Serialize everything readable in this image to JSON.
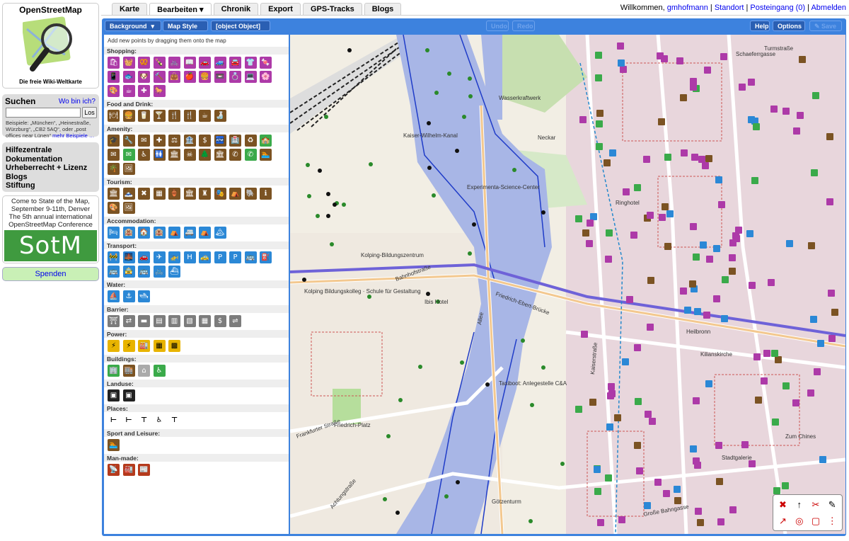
{
  "sidebar": {
    "logo_title": "OpenStreetMap",
    "logo_subtitle": "Die freie Wiki-Weltkarte",
    "search_title": "Suchen",
    "where_link": "Wo bin ich?",
    "search_value": "",
    "search_button": "Los",
    "search_help": "Beispiele: „München“, „Heinestraße, Würzburg“, „CB2 5AQ“, oder „post offices near Lünen“",
    "search_more": "mehr Beispiele …",
    "links": [
      "Hilfezentrale",
      "Dokumentation",
      "Urheberrecht + Lizenz",
      "Blogs",
      "Stiftung"
    ],
    "sotm_text_1": "Come to State of the Map,",
    "sotm_text_2": "September 9-11th, Denver",
    "sotm_text_3": "The 5th annual international",
    "sotm_text_4": "OpenStreetMap Conference",
    "sotm_logo": "SotM",
    "donate": "Spenden"
  },
  "tabs": [
    "Karte",
    "Bearbeiten ▾",
    "Chronik",
    "Export",
    "GPS-Tracks",
    "Blogs"
  ],
  "userbar": {
    "welcome": "Willkommen, ",
    "user": "gmhofmann",
    "sep": " | ",
    "location": "Standort",
    "inbox": "Posteingang (0)",
    "logout": "Abmelden"
  },
  "toolbar": {
    "background": "Background",
    "map_style": "Map Style",
    "object": "[object Object]",
    "undo": "Undo",
    "redo": "Redo",
    "help": "Help",
    "options": "Options",
    "save": "Save"
  },
  "palette": {
    "hint": "Add new points by dragging them onto the map",
    "categories": [
      {
        "label": "Shopping:",
        "style": "c-shop",
        "icons": [
          "🛍",
          "🧺",
          "🥨",
          "🍾",
          "🚲",
          "📖",
          "🚗",
          "🚙",
          "🚘",
          "👕",
          "🍬",
          "📱",
          "🐟",
          "🐶",
          "🔨",
          "👜",
          "🍎",
          "🍔",
          "📼",
          "💍",
          "💻",
          "🌸",
          "🎨",
          "☕",
          "✚",
          "🐎"
        ]
      },
      {
        "label": "Food and Drink:",
        "style": "c-food",
        "icons": [
          "🍽",
          "🍔",
          "🥛",
          "🍸",
          "🍴",
          "🍴",
          "☕",
          "🍶"
        ]
      },
      {
        "label": "Amenity:",
        "style": "c-amen",
        "icons": [
          "🎓",
          "🔧",
          "✉",
          "✚",
          "⚖",
          "🏦",
          "$",
          "🏧",
          "🏥",
          "♻",
          "🏫",
          "✉",
          "✉",
          "♿",
          "🚻",
          "🏛",
          "☠",
          "🌲",
          "🏛",
          "✆",
          "✆",
          "🏊",
          "🌴",
          "🖼"
        ]
      },
      {
        "label": "Tourism:",
        "style": "c-tour",
        "icons": [
          "🏛",
          "🗻",
          "✖",
          "▦",
          "🏺",
          "🏛",
          "♜",
          "🎭",
          "⛺",
          "🐘",
          "ℹ",
          "🎨",
          "🖼"
        ]
      },
      {
        "label": "Accommodation:",
        "style": "c-blue",
        "icons": [
          "🛏",
          "🏨",
          "🏠",
          "🏨",
          "⛺",
          "🚐",
          "⛺",
          "🏔"
        ]
      },
      {
        "label": "Transport:",
        "style": "c-blue",
        "icons": [
          "🚧",
          "🌉",
          "🚗",
          "✈",
          "🚁",
          "H",
          "🚕",
          "P",
          "P",
          "🚌",
          "⛽",
          "🚌",
          "🚖",
          "🚌",
          "🚲",
          "⛴"
        ]
      },
      {
        "label": "Water:",
        "style": "c-blue",
        "icons": [
          "⛵",
          "⚓",
          "🛥"
        ]
      },
      {
        "label": "Barrier:",
        "style": "c-grey",
        "icons": [
          "⛩",
          "⇄",
          "▬",
          "▤",
          "▥",
          "▧",
          "▦",
          "$",
          "⇌"
        ]
      },
      {
        "label": "Power:",
        "style": "c-power",
        "icons": [
          "⚡",
          "⚡",
          "🏭",
          "▦",
          "▩"
        ]
      },
      {
        "label": "Buildings:",
        "style": "c-build",
        "icons": [
          "🏢",
          "🏬",
          "⌂",
          "♿"
        ]
      },
      {
        "label": "Landuse:",
        "style": "c-land",
        "icons": [
          "▣",
          "▣"
        ]
      },
      {
        "label": "Places:",
        "style": "c-place",
        "icons": [
          "⊢",
          "⊢",
          "⊤",
          "♿",
          "⊤"
        ]
      },
      {
        "label": "Sport and Leisure:",
        "style": "c-sport",
        "icons": [
          "🏊"
        ]
      },
      {
        "label": "Man-made:",
        "style": "c-man",
        "icons": [
          "📡",
          "🏭",
          "📰"
        ]
      }
    ]
  },
  "map": {
    "labels": [
      {
        "t": "Kaiser-Wilhelm-Kanal"
      },
      {
        "t": "Wasserkraftwerk"
      },
      {
        "t": "Neckar"
      },
      {
        "t": "Experimenta-Science-Center"
      },
      {
        "t": "Ringhotel"
      },
      {
        "t": "Kolping-Bildungszentrum"
      },
      {
        "t": "Kolping Bildungskolleg · Schule für Gestaltung"
      },
      {
        "t": "Ibis Hotel"
      },
      {
        "t": "Bahnhofstraße"
      },
      {
        "t": "Friedrich-Ebert-Brücke"
      },
      {
        "t": "Kilianskirche"
      },
      {
        "t": "Heilbronn"
      },
      {
        "t": "Taxiboot: Anlegestelle C&A"
      },
      {
        "t": "Friedrich-Platz"
      },
      {
        "t": "Frankfurter Straße"
      },
      {
        "t": "Achtungstraße"
      },
      {
        "t": "Stadtgalerie"
      },
      {
        "t": "Götzenturm"
      },
      {
        "t": "Kaiserstraße"
      },
      {
        "t": "Allee"
      },
      {
        "t": "Schaeferrgasse"
      },
      {
        "t": "Turmstraße"
      },
      {
        "t": "Zum Chines"
      },
      {
        "t": "Große Bahngasse"
      }
    ]
  },
  "tools": [
    "✖",
    "↑",
    "✂",
    "✎",
    "↗",
    "◎",
    "▢",
    "⋮"
  ]
}
